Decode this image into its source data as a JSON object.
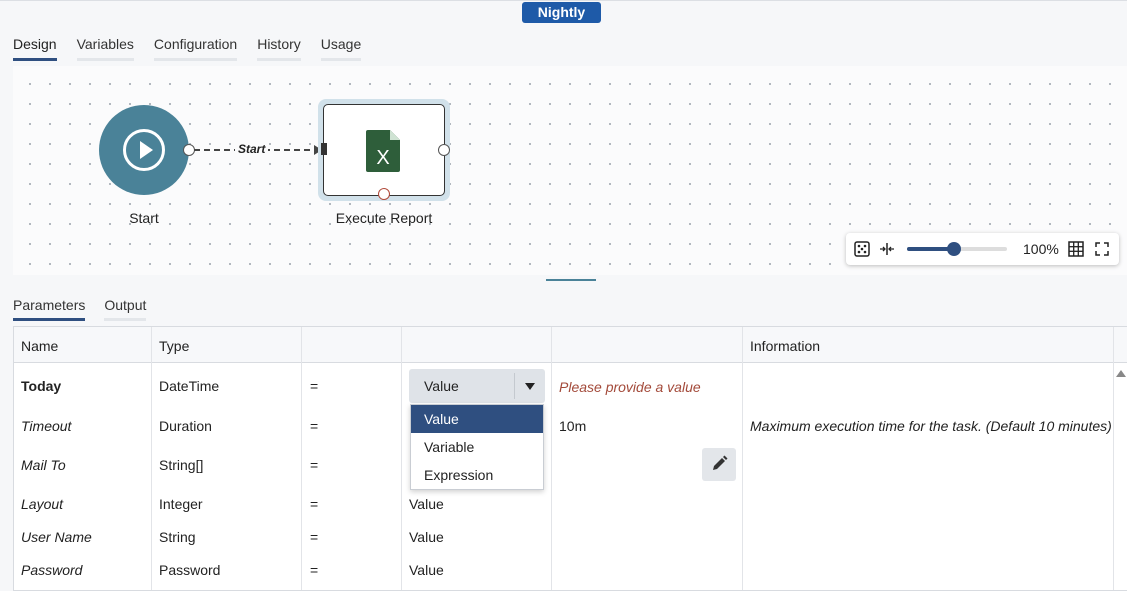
{
  "header": {
    "environment_badge": "Nightly"
  },
  "tabs": [
    {
      "label": "Design",
      "active": true
    },
    {
      "label": "Variables",
      "active": false
    },
    {
      "label": "Configuration",
      "active": false
    },
    {
      "label": "History",
      "active": false
    },
    {
      "label": "Usage",
      "active": false
    }
  ],
  "workflow": {
    "start_node": {
      "label": "Start",
      "icon": "play-circle-icon"
    },
    "edge_label": "Start",
    "task_node": {
      "label": "Execute Report",
      "icon": "excel-file-icon",
      "icon_letter": "X"
    }
  },
  "zoom": {
    "value_text": "100%",
    "level_fraction": 0.47
  },
  "subtabs": [
    {
      "label": "Parameters",
      "active": true
    },
    {
      "label": "Output",
      "active": false
    }
  ],
  "grid": {
    "headers": [
      "Name",
      "Type",
      "",
      "",
      "",
      "Information"
    ],
    "rows": [
      {
        "name": "Today",
        "type": "DateTime",
        "op": "=",
        "mode": "Value",
        "value": "",
        "info": ""
      },
      {
        "name": "Timeout",
        "type": "Duration",
        "op": "=",
        "mode": "",
        "value": "10m",
        "info": "Maximum execution time for the task. (Default 10 minutes)"
      },
      {
        "name": "Mail To",
        "type": "String[]",
        "op": "=",
        "mode": "",
        "value": "",
        "info": ""
      },
      {
        "name": "Layout",
        "type": "Integer",
        "op": "=",
        "mode": "Value",
        "value": "",
        "info": ""
      },
      {
        "name": "User Name",
        "type": "String",
        "op": "=",
        "mode": "Value",
        "value": "",
        "info": ""
      },
      {
        "name": "Password",
        "type": "Password",
        "op": "=",
        "mode": "Value",
        "value": "",
        "info": ""
      }
    ],
    "validation_message": "Please provide a value",
    "dropdown_options": [
      "Value",
      "Variable",
      "Expression"
    ]
  },
  "colors": {
    "accent": "#2f4f80",
    "start_node": "#4a8298",
    "badge": "#1e5aa8",
    "error": "#a34a3a",
    "excel": "#2e5e3a"
  }
}
